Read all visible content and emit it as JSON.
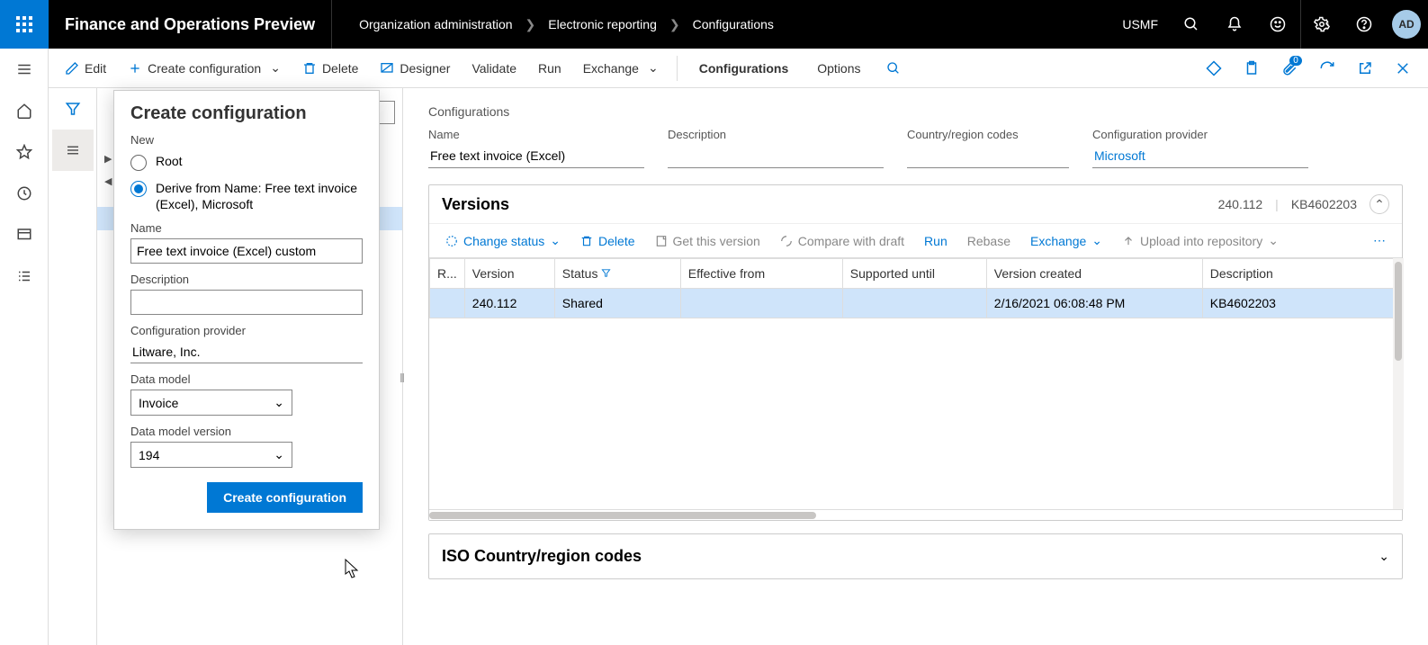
{
  "topbar": {
    "app_title": "Finance and Operations Preview",
    "breadcrumbs": [
      "Organization administration",
      "Electronic reporting",
      "Configurations"
    ],
    "company": "USMF",
    "avatar": "AD"
  },
  "actions": {
    "edit": "Edit",
    "create_conf": "Create configuration",
    "delete": "Delete",
    "designer": "Designer",
    "validate": "Validate",
    "run": "Run",
    "exchange": "Exchange"
  },
  "tabs": {
    "configurations": "Configurations",
    "options": "Options"
  },
  "badge_count": "0",
  "popover": {
    "title": "Create configuration",
    "new_label": "New",
    "root_label": "Root",
    "derive_label": "Derive from Name: Free text invoice (Excel), Microsoft",
    "name_label": "Name",
    "name_value": "Free text invoice (Excel) custom",
    "desc_label": "Description",
    "desc_value": "",
    "provider_label": "Configuration provider",
    "provider_value": "Litware, Inc.",
    "model_label": "Data model",
    "model_value": "Invoice",
    "model_ver_label": "Data model version",
    "model_ver_value": "194",
    "submit": "Create configuration"
  },
  "detail": {
    "section": "Configurations",
    "name_label": "Name",
    "name_value": "Free text invoice (Excel)",
    "desc_label": "Description",
    "desc_value": "",
    "country_label": "Country/region codes",
    "country_value": "",
    "provider_label": "Configuration provider",
    "provider_value": "Microsoft"
  },
  "versions": {
    "title": "Versions",
    "hdr_version": "240.112",
    "hdr_kb": "KB4602203",
    "tools": {
      "change_status": "Change status",
      "delete": "Delete",
      "get_version": "Get this version",
      "compare": "Compare with draft",
      "run": "Run",
      "rebase": "Rebase",
      "exchange": "Exchange",
      "upload": "Upload into repository"
    },
    "columns": {
      "r": "R...",
      "version": "Version",
      "status": "Status",
      "effective": "Effective from",
      "supported": "Supported until",
      "created": "Version created",
      "desc": "Description"
    },
    "rows": [
      {
        "version": "240.112",
        "status": "Shared",
        "effective": "",
        "supported": "",
        "created": "2/16/2021 06:08:48 PM",
        "desc": "KB4602203"
      }
    ]
  },
  "iso": {
    "title": "ISO Country/region codes"
  }
}
